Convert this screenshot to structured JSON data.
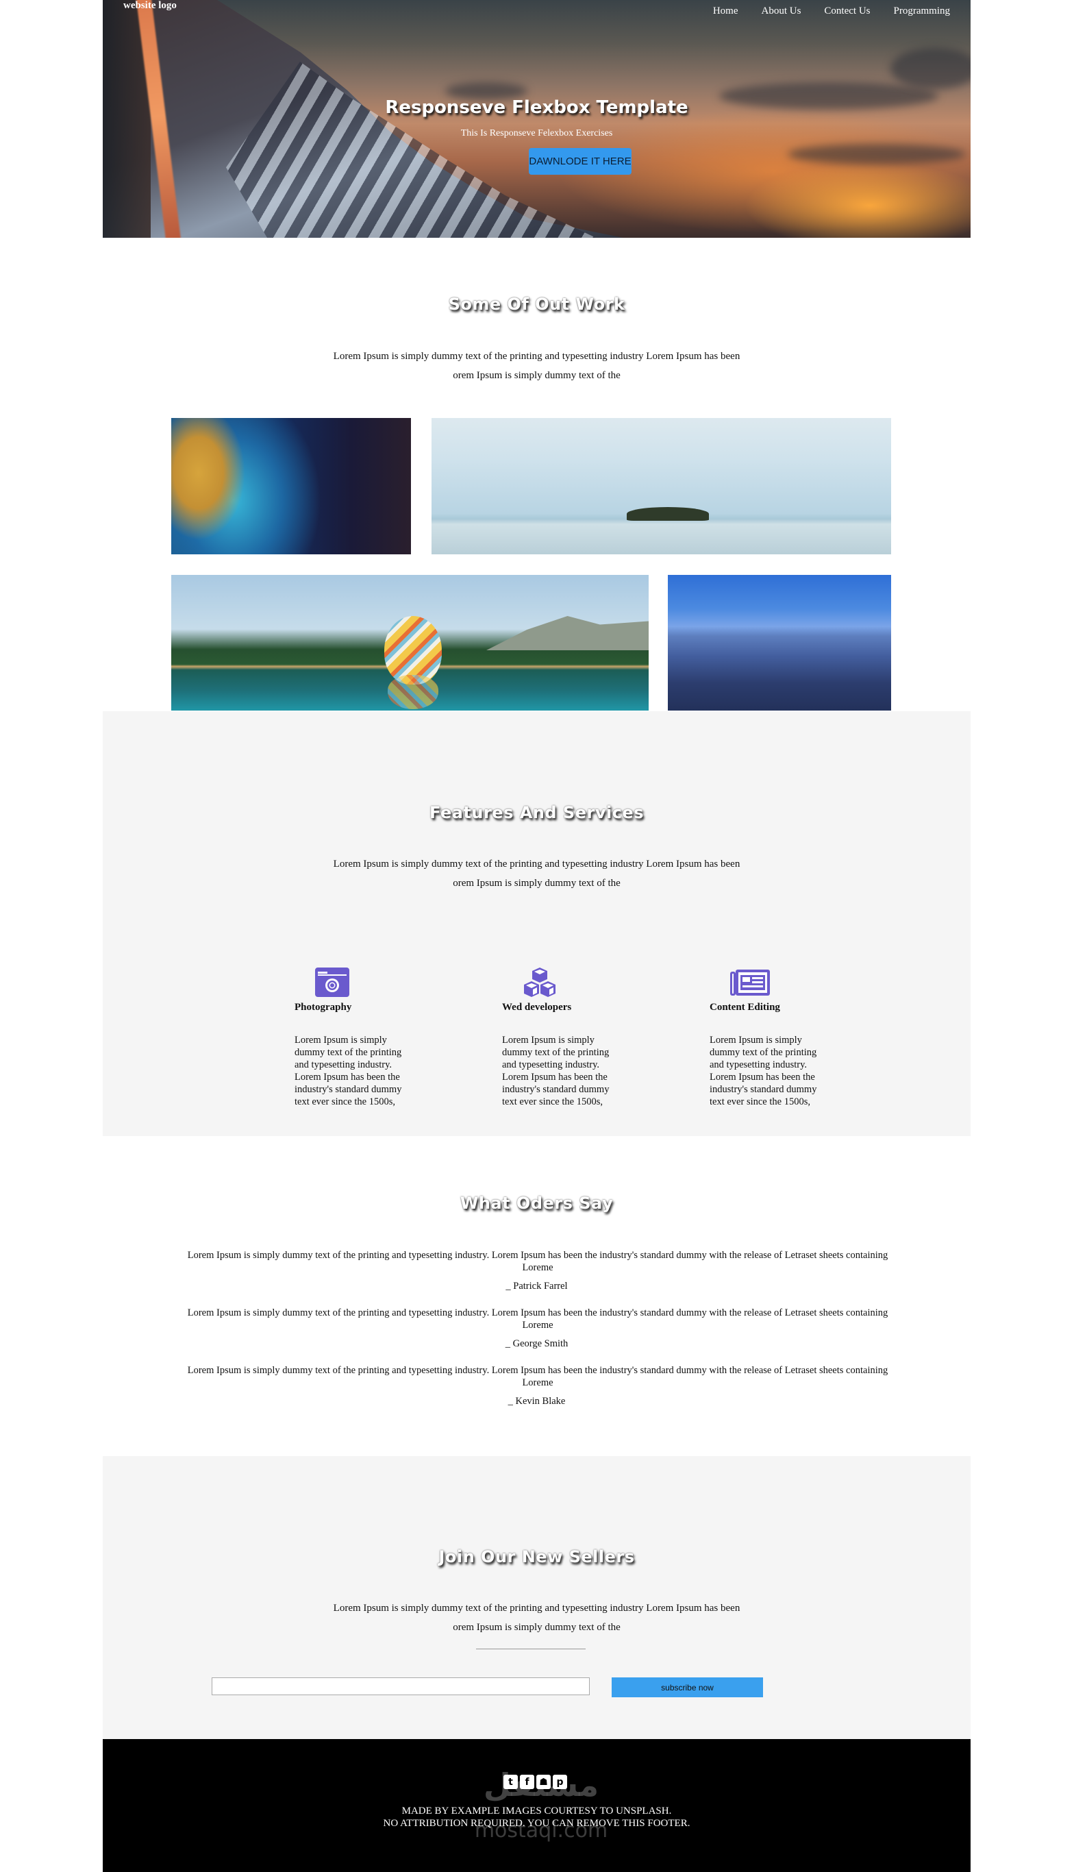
{
  "header": {
    "logo": "website logo",
    "nav": [
      {
        "label": "Home"
      },
      {
        "label": "About Us"
      },
      {
        "label": "Contect Us"
      },
      {
        "label": "Programming"
      }
    ],
    "hero_title": "Responseve Flexbox Template",
    "hero_subtitle": "This Is Responseve Felexbox Exercises",
    "hero_button": "DAWNLODE IT HERE"
  },
  "work": {
    "heading": "Some Of Out Work",
    "paragraph_line1": "Lorem Ipsum is simply dummy text of the printing and typesetting industry Lorem Ipsum has been",
    "paragraph_line2": "orem Ipsum is simply dummy text of the",
    "gallery": [
      {
        "name": "ocean-aerial-image"
      },
      {
        "name": "island-sea-image"
      },
      {
        "name": "hot-air-balloon-lake-image"
      },
      {
        "name": "blue-mountains-image"
      }
    ]
  },
  "features": {
    "heading": "Features And Services",
    "paragraph_line1": "Lorem Ipsum is simply dummy text of the printing and typesetting industry Lorem Ipsum has been",
    "paragraph_line2": "orem Ipsum is simply dummy text of the",
    "icon_color": "#6a5acd",
    "items": [
      {
        "icon": "camera-icon",
        "title": "Photography",
        "text": "Lorem Ipsum is simply dummy text of the printing and typesetting industry. Lorem Ipsum has been the industry's standard dummy text ever since the 1500s,"
      },
      {
        "icon": "cubes-icon",
        "title": "Wed developers",
        "text": "Lorem Ipsum is simply dummy text of the printing and typesetting industry. Lorem Ipsum has been the industry's standard dummy text ever since the 1500s,"
      },
      {
        "icon": "newspaper-icon",
        "title": "Content Editing",
        "text": "Lorem Ipsum is simply dummy text of the printing and typesetting industry. Lorem Ipsum has been the industry's standard dummy text ever since the 1500s,"
      }
    ]
  },
  "testimonials": {
    "heading": "What Oders Say",
    "items": [
      {
        "quote": "Lorem Ipsum is simply dummy text of the printing and typesetting industry. Lorem Ipsum has been the industry's standard dummy with the release of Letraset sheets containing Loreme",
        "author": "_ Patrick Farrel"
      },
      {
        "quote": "Lorem Ipsum is simply dummy text of the printing and typesetting industry. Lorem Ipsum has been the industry's standard dummy with the release of Letraset sheets containing Loreme",
        "author": "_ George Smith"
      },
      {
        "quote": "Lorem Ipsum is simply dummy text of the printing and typesetting industry. Lorem Ipsum has been the industry's standard dummy with the release of Letraset sheets containing Loreme",
        "author": "_ Kevin Blake"
      }
    ]
  },
  "subscribe": {
    "heading": "Join Our New Sellers",
    "paragraph_line1": "Lorem Ipsum is simply dummy text of the printing and typesetting industry Lorem Ipsum has been",
    "paragraph_line2": "orem Ipsum is simply dummy text of the",
    "input_value": "",
    "input_placeholder": "",
    "button": "subscribe now",
    "button_color": "#3aa0ee"
  },
  "footer": {
    "social": [
      {
        "icon": "twitter-icon",
        "glyph": "t"
      },
      {
        "icon": "facebook-icon",
        "glyph": "f"
      },
      {
        "icon": "snapchat-icon",
        "glyph": "☗"
      },
      {
        "icon": "pinterest-icon",
        "glyph": "p"
      }
    ],
    "line1": "MADE BY EXAMPLE IMAGES COURTESY TO UNSPLASH.",
    "line2": "NO ATTRIBUTION REQUIRED. YOU CAN REMOVE THIS FOOTER.",
    "watermark": "مستقل",
    "watermark_url": "mostaql.com"
  },
  "colors": {
    "accent_blue": "#3399ee",
    "section_gray": "#f5f5f5",
    "footer_bg": "#000000"
  }
}
